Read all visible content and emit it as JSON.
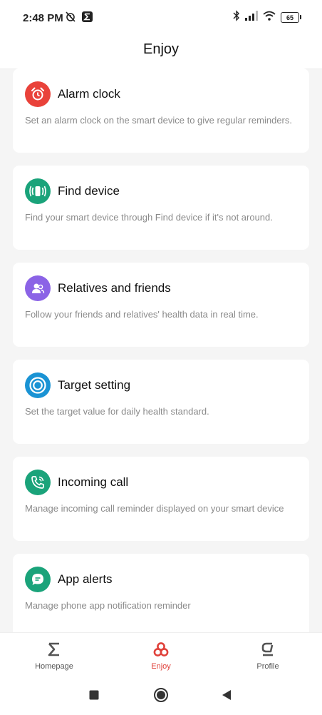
{
  "status_bar": {
    "time": "2:48 PM",
    "battery": "65",
    "icons": [
      "alarm-off-icon",
      "sigma-app-icon",
      "bluetooth-icon",
      "signal-icon",
      "wifi-icon",
      "battery-icon"
    ]
  },
  "header": {
    "title": "Enjoy"
  },
  "cards": [
    {
      "title": "Alarm clock",
      "desc": "Set an alarm clock on the smart device to give regular reminders.",
      "icon": "alarm-clock-icon",
      "color": "#e9423a"
    },
    {
      "title": "Find device",
      "desc": "Find your smart device through Find device if it's not around.",
      "icon": "find-device-icon",
      "color": "#1aa37a"
    },
    {
      "title": "Relatives and friends",
      "desc": "Follow your friends and relatives' health data in real time.",
      "icon": "friends-icon",
      "color": "#8b63e6"
    },
    {
      "title": "Target setting",
      "desc": "Set the target value for daily health standard.",
      "icon": "target-icon",
      "color": "#1a93d4"
    },
    {
      "title": "Incoming call",
      "desc": "Manage incoming call reminder displayed on your smart device",
      "icon": "phone-call-icon",
      "color": "#1aa37a"
    },
    {
      "title": "App alerts",
      "desc": "Manage phone app notification reminder",
      "icon": "chat-bubble-icon",
      "color": "#1aa37a"
    }
  ],
  "bottom_nav": {
    "items": [
      {
        "label": "Homepage",
        "icon": "sigma-icon"
      },
      {
        "label": "Enjoy",
        "icon": "enjoy-icon",
        "active": true
      },
      {
        "label": "Profile",
        "icon": "profile-icon"
      }
    ],
    "accent": "#e0413a"
  },
  "system_nav": {
    "icons": [
      "recent-apps-icon",
      "home-icon",
      "back-icon"
    ]
  }
}
